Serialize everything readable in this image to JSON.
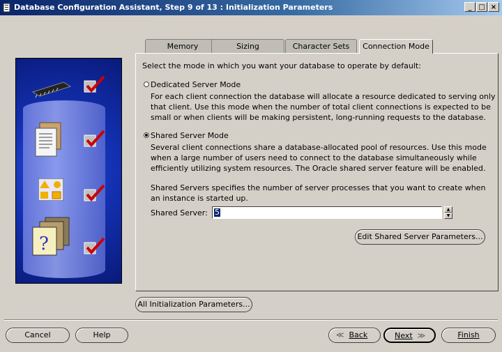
{
  "window": {
    "title": "Database Configuration Assistant, Step 9 of 13 : Initialization Parameters",
    "controls": [
      "minimize",
      "maximize",
      "close"
    ]
  },
  "tabs": [
    {
      "label": "Memory",
      "active": false
    },
    {
      "label": "Sizing",
      "active": false
    },
    {
      "label": "Character Sets",
      "active": false
    },
    {
      "label": "Connection Mode",
      "active": true
    }
  ],
  "panel": {
    "intro": "Select the mode in which you want your database to operate by default:",
    "dedicated": {
      "label": "Dedicated Server Mode",
      "selected": false,
      "description": "For each client connection the database will allocate a resource dedicated to serving only that client. Use this mode when the number of total client connections is expected to be small or when clients will be making persistent, long-running requests to the database."
    },
    "shared": {
      "label": "Shared Server Mode",
      "selected": true,
      "description": "Several client connections share a database-allocated pool of resources. Use this mode when a large number of users need to connect to the database simultaneously while efficiently utilizing system resources. The Oracle shared server feature will be enabled."
    },
    "shared_servers_note": "Shared Servers specifies the number of server processes that you want to create when an instance is started up.",
    "shared_server_label": "Shared Server:",
    "shared_server_value": "5",
    "edit_button": "Edit Shared Server Parameters..."
  },
  "all_params_button": "All Initialization Parameters...",
  "footer": {
    "cancel": "Cancel",
    "help": "Help",
    "back": "Back",
    "next": "Next",
    "finish": "Finish"
  },
  "colors": {
    "titlebar": "#0a246a",
    "check": "#cc0000",
    "sidebar": "#1230b0"
  }
}
